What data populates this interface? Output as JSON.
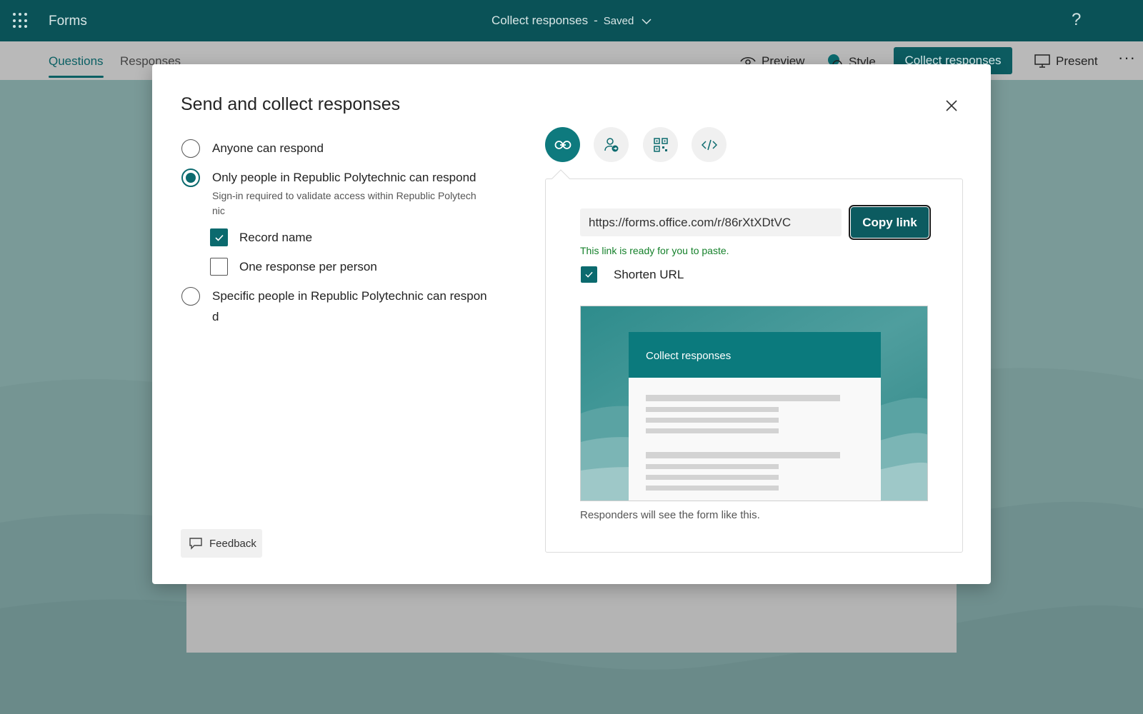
{
  "app": {
    "name": "Forms"
  },
  "document": {
    "title": "Collect responses",
    "separator": "-",
    "status": "Saved"
  },
  "subnav": {
    "tabs": [
      {
        "label": "Questions"
      },
      {
        "label": "Responses"
      }
    ],
    "actions": {
      "preview": "Preview",
      "style": "Style",
      "collect": "Collect responses",
      "present": "Present"
    }
  },
  "dialog": {
    "title": "Send and collect responses",
    "options": {
      "anyone": {
        "label": "Anyone can respond",
        "selected": false
      },
      "only": {
        "label": "Only people in Republic Polytechnic can respond",
        "sublabel": "Sign-in required to validate access within Republic Polytech nic",
        "selected": true
      },
      "specific": {
        "label": "Specific people in Republic Polytechnic can respon d",
        "selected": false
      }
    },
    "checkboxes": {
      "record_name": {
        "label": "Record name",
        "checked": true
      },
      "one_response": {
        "label": "One response per person",
        "checked": false
      }
    },
    "feedback_label": "Feedback",
    "share_methods": [
      {
        "icon": "link-icon",
        "active": true
      },
      {
        "icon": "invite-people-icon",
        "active": false
      },
      {
        "icon": "qr-code-icon",
        "active": false
      },
      {
        "icon": "embed-code-icon",
        "active": false
      }
    ],
    "link": {
      "url": "https://forms.office.com/r/86rXtXDtVC",
      "copy_label": "Copy link",
      "ready_message": "This link is ready for you to paste.",
      "shorten_label": "Shorten URL",
      "shorten_checked": true
    },
    "preview": {
      "form_title": "Collect responses",
      "caption": "Responders will see the form like this."
    }
  },
  "colors": {
    "header": "#0a5257",
    "accent": "#0b6a6e",
    "success": "#15812b"
  }
}
